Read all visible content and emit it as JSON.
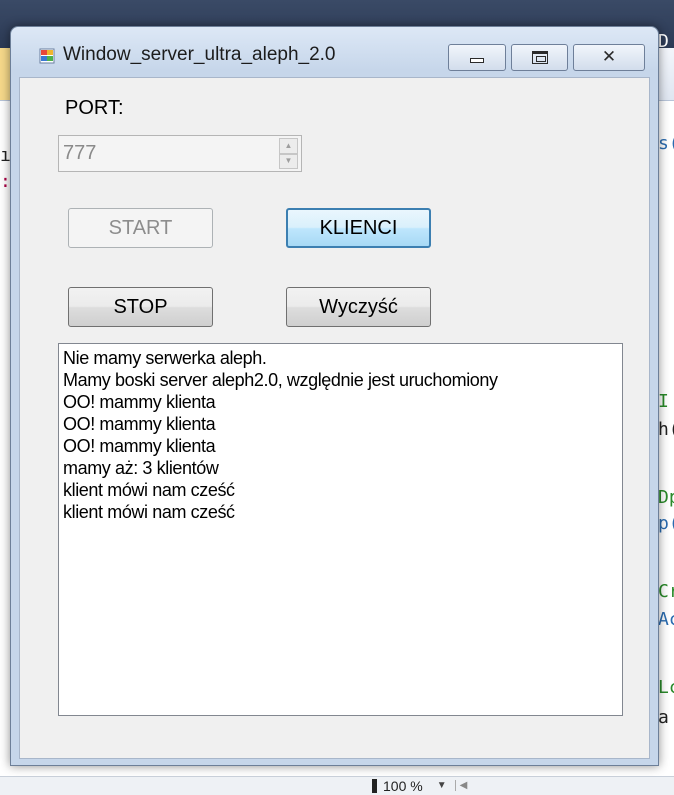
{
  "window": {
    "title": "Window_server_ultra_aleph_2.0"
  },
  "port": {
    "label": "PORT:",
    "value": "777"
  },
  "buttons": {
    "start": "START",
    "klienci": "KLIENCI",
    "stop": "STOP",
    "clear": "Wyczyść"
  },
  "log": [
    "Nie mamy serwerka aleph.",
    "Mamy boski server aleph2.0, względnie jest uruchomiony",
    "OO! mammy klienta",
    "OO! mammy klienta",
    "OO! mammy klienta",
    "mamy aż: 3 klientów",
    "klient mówi nam cześć",
    "klient mówi nam cześć"
  ],
  "background": {
    "zoom": "100 %",
    "right_edge_fragments": [
      "D",
      "s(",
      "I",
      "h(",
      "Dp",
      "p(",
      "Cr",
      "Ac",
      "Lc",
      "a"
    ]
  },
  "colors": {
    "window_frame": "#c6d6ea",
    "client_bg": "#f0f0f0",
    "focused_button_border": "#3c7fb1"
  }
}
